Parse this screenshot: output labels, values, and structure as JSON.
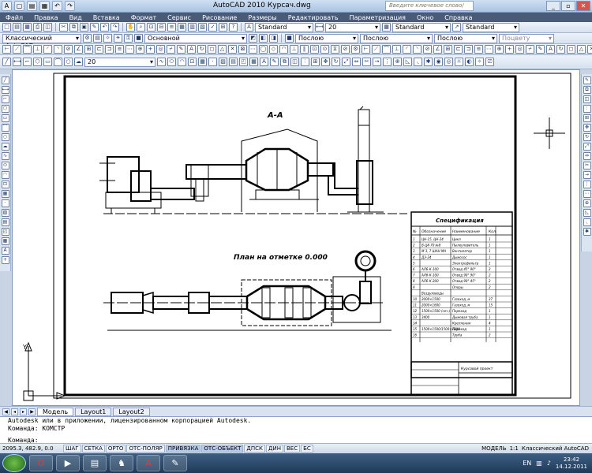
{
  "window": {
    "title": "AutoCAD 2010     Курсач.dwg",
    "search_placeholder": "Введите ключевое слово/фразу"
  },
  "menu": [
    "Файл",
    "Правка",
    "Вид",
    "Вставка",
    "Формат",
    "Сервис",
    "Рисование",
    "Размеры",
    "Редактировать",
    "Параметризация",
    "Окно",
    "Справка"
  ],
  "toolbar1": {
    "layer_combo": "0",
    "style1": "Standard",
    "dim_value": "20",
    "style2": "Standard",
    "style3": "Standard"
  },
  "toolbar2": {
    "workspace": "Классический AutoCAD",
    "layer": "Основной",
    "color": "Послою",
    "linetype": "Послою",
    "lineweight": "Послою",
    "plotstyle": "Поцвету"
  },
  "toolbar4": {
    "scale_value": "20"
  },
  "drawing": {
    "section_title": "А-А",
    "plan_title": "План на отметке 0.000",
    "spec_title": "Спецификация",
    "spec_headers": [
      "№",
      "Обозначение",
      "Наименование",
      "Кол."
    ],
    "spec_rows": [
      [
        "1",
        "ЦН-15, ЦН-24",
        "Цикл",
        "1"
      ],
      [
        "2",
        "В-Ц4-70 №8",
        "Пылеуловитель",
        "1"
      ],
      [
        "3",
        "М 3, 7 ШАН МА",
        "Вентилятор",
        "1"
      ],
      [
        "4",
        "ДЭ-24",
        "Дымосос",
        "1"
      ],
      [
        "5",
        "",
        "Электрофильтр",
        "1"
      ],
      [
        "6",
        "АЛ6-К-100",
        "Отвод 45° 90°",
        "2"
      ],
      [
        "7",
        "АЛ6-К-100",
        "Отвод 90° 90°",
        "2"
      ],
      [
        "8",
        "АЛ6-К-200",
        "Отвод 90° 45°",
        "2"
      ],
      [
        "9",
        "",
        "Опоры",
        "2"
      ],
      [
        "",
        "Воздуховоды",
        "",
        ""
      ],
      [
        "10",
        "2000×1500",
        "Газоход, м",
        "37"
      ],
      [
        "11",
        "2000×1600",
        "Газоход, м",
        "15"
      ],
      [
        "12",
        "1500×1500 (сеч.)",
        "Переход",
        "1"
      ],
      [
        "13",
        "3400",
        "Дымовая труба",
        "1"
      ],
      [
        "14",
        "",
        "Крепления",
        "4"
      ],
      [
        "15",
        "1500×1500/1500×2000",
        "Переход",
        "1"
      ],
      [
        "16",
        "",
        "Труба",
        "2"
      ]
    ],
    "stamp_text": "Курсовой проект"
  },
  "tabs": {
    "model": "Модель",
    "layout1": "Layout1",
    "layout2": "Layout2"
  },
  "command": {
    "line1": "Autodesk или в приложении, лицензированном корпорацией Autodesk.",
    "line2": "Команда: КОМСТР",
    "prompt": "Команда:"
  },
  "status": {
    "coords": "2095.3, 482.9, 0.0",
    "modes": [
      "ШАГ",
      "СЕТКА",
      "ОРТО",
      "ОТС-ПОЛЯР",
      "ПРИВЯЗКА",
      "ОТС-ОБЪЕКТ",
      "ДПСК",
      "ДИН",
      "ВЕС",
      "БС"
    ],
    "model": "МОДЕЛЬ",
    "scale": "1:1",
    "workspace": "Классический AutoCAD"
  },
  "taskbar": {
    "lang": "EN",
    "time": "23:42",
    "date": "14.12.2011"
  }
}
